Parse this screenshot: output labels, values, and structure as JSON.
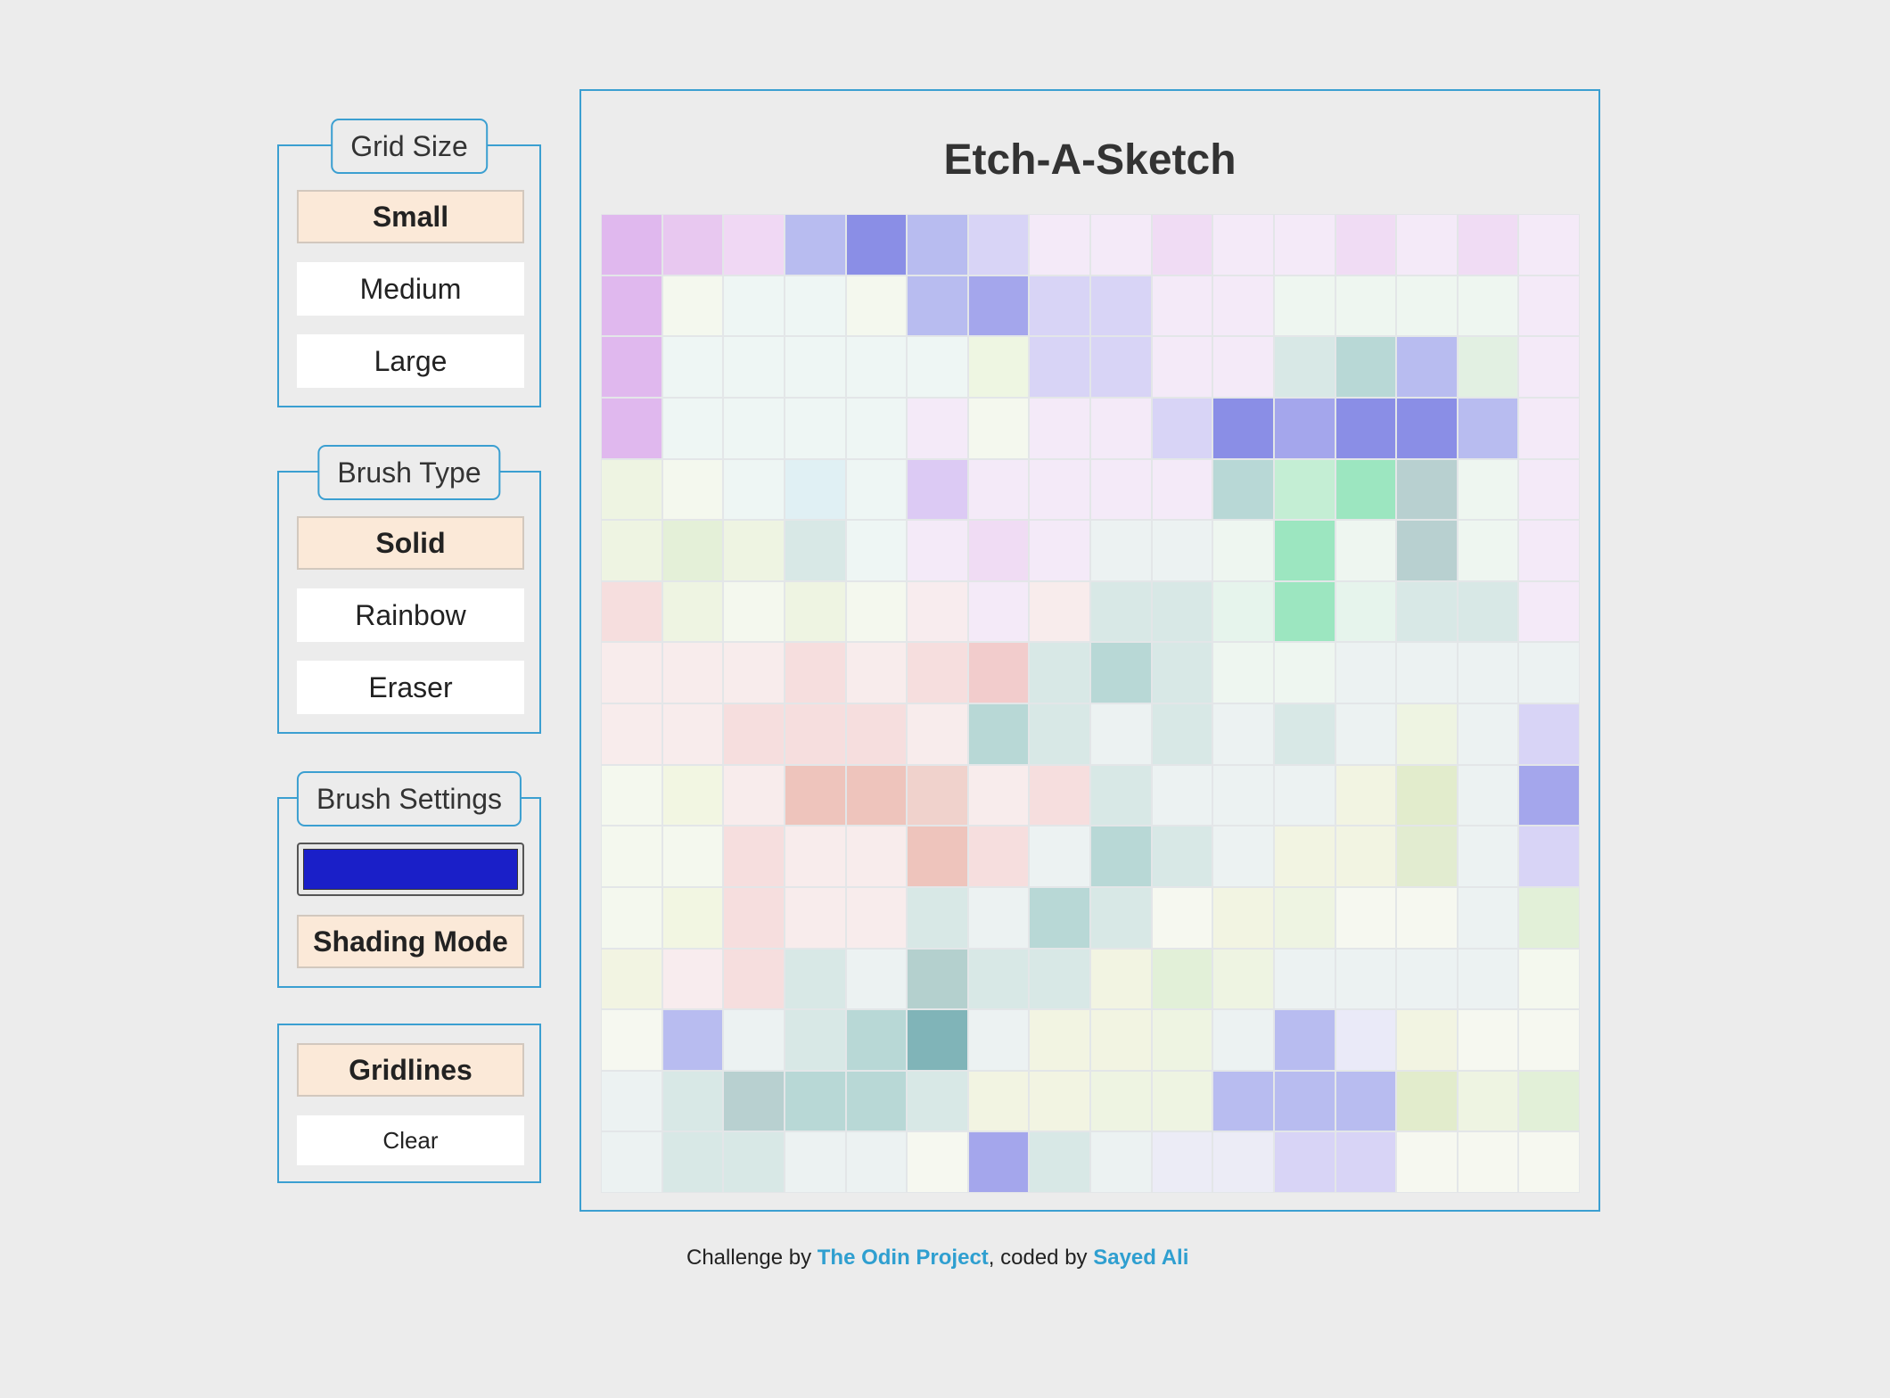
{
  "grid_size": {
    "legend": "Grid Size",
    "options": [
      "Small",
      "Medium",
      "Large"
    ],
    "active": "Small"
  },
  "brush_type": {
    "legend": "Brush Type",
    "options": [
      "Solid",
      "Rainbow",
      "Eraser"
    ],
    "active": "Solid"
  },
  "brush_settings": {
    "legend": "Brush Settings",
    "color": "#1a1fc8",
    "shading_label": "Shading Mode"
  },
  "actions": {
    "gridlines_label": "Gridlines",
    "clear_label": "Clear"
  },
  "title": "Etch-A-Sketch",
  "footer": {
    "prefix": "Challenge by ",
    "odin": "The Odin Project",
    "middle": ", coded by ",
    "author": "Sayed Ali"
  },
  "grid": {
    "size": 16,
    "cells": [
      [
        "#e0b8ee",
        "#e8c8f0",
        "#f0d8f4",
        "#b8bcf0",
        "#8a8ee6",
        "#b8bcf0",
        "#d8d4f6",
        "#f4eaf8",
        "#f4eaf8",
        "#f0dcf4",
        "#f4eaf8",
        "#f4eaf8",
        "#f0dcf4",
        "#f4eaf8",
        "#f0dcf4",
        "#f4eaf8"
      ],
      [
        "#e0b8ee",
        "#f4f8ee",
        "#eef6f4",
        "#eef6f4",
        "#f4f8ee",
        "#b8bcf0",
        "#a4a6ec",
        "#d8d4f6",
        "#d8d4f6",
        "#f4eaf8",
        "#f4eaf8",
        "#eef6f0",
        "#eef6f0",
        "#eef6f0",
        "#eef6f0",
        "#f4eaf8"
      ],
      [
        "#e0b8ee",
        "#eef6f4",
        "#eef6f4",
        "#eef6f4",
        "#eef6f4",
        "#eef6f4",
        "#eef6e2",
        "#d8d4f6",
        "#d8d4f6",
        "#f4eaf8",
        "#f4eaf8",
        "#d8e8e6",
        "#b8d8d6",
        "#b8bcf0",
        "#e2f0e2",
        "#f4eaf8"
      ],
      [
        "#e0b8ee",
        "#eef6f4",
        "#eef6f4",
        "#eef6f4",
        "#eef6f4",
        "#f4eaf8",
        "#f4f8ee",
        "#f4eaf8",
        "#f4eaf8",
        "#d8d4f6",
        "#8a8ee6",
        "#a4a6ec",
        "#8a8ee6",
        "#8a8ee6",
        "#b8bcf0",
        "#f4eaf8"
      ],
      [
        "#eef4e2",
        "#f4f8ee",
        "#eef6f4",
        "#e0f0f4",
        "#eef6f4",
        "#dccaf4",
        "#f4eaf8",
        "#f4eaf8",
        "#f4eaf8",
        "#f4eaf8",
        "#b8d8d6",
        "#c4eed4",
        "#9ce6c0",
        "#b8d0d0",
        "#eef6f0",
        "#f4eaf8"
      ],
      [
        "#eef4e2",
        "#e4f0d8",
        "#eef4e2",
        "#d8e8e6",
        "#eef6f4",
        "#f4eaf8",
        "#f0dcf4",
        "#f4eaf8",
        "#ecf2f2",
        "#ecf2f2",
        "#eef6f0",
        "#9ce6c0",
        "#eef6f0",
        "#b8d0d0",
        "#eef6f0",
        "#f4eaf8"
      ],
      [
        "#f6dede",
        "#eef4e2",
        "#f4f8ee",
        "#eef4e2",
        "#f4f8ee",
        "#f8ecee",
        "#f4eaf8",
        "#f8ecec",
        "#d8e8e6",
        "#d8e8e6",
        "#e6f4ec",
        "#9ce6c0",
        "#e6f4ec",
        "#d8e8e6",
        "#d8e8e6",
        "#f4eaf8"
      ],
      [
        "#f8ecec",
        "#f8ecec",
        "#f8ecec",
        "#f6dede",
        "#f8ecec",
        "#f6dede",
        "#f2cccc",
        "#d8e8e6",
        "#b8d8d6",
        "#d8e8e6",
        "#eef6f0",
        "#eef6f0",
        "#ecf2f2",
        "#ecf2f2",
        "#ecf2f2",
        "#ecf2f2"
      ],
      [
        "#f8ecec",
        "#f8ecec",
        "#f6dede",
        "#f6dede",
        "#f6dede",
        "#f8ecec",
        "#b8d8d6",
        "#d8e8e6",
        "#ecf2f2",
        "#d8e8e6",
        "#ecf2f2",
        "#d8e8e6",
        "#ecf2f2",
        "#eef4e2",
        "#ecf2f2",
        "#d8d4f6"
      ],
      [
        "#f4f8ee",
        "#f2f6e2",
        "#f8ecec",
        "#eec4bc",
        "#eec4bc",
        "#f0d2cc",
        "#f8ecec",
        "#f6dede",
        "#d8e8e6",
        "#ecf2f2",
        "#ecf2f2",
        "#ecf2f2",
        "#f2f4e2",
        "#e2eccc",
        "#ecf2f2",
        "#a4a6ec"
      ],
      [
        "#f4f8ee",
        "#f4f8ee",
        "#f6dede",
        "#f8ecec",
        "#f8ecec",
        "#eec4bc",
        "#f6dede",
        "#ecf2f2",
        "#b8d8d6",
        "#d8e8e6",
        "#ecf2f2",
        "#f2f4e2",
        "#f2f4e2",
        "#e2ecd0",
        "#ecf2f2",
        "#d8d4f6"
      ],
      [
        "#f4f8ee",
        "#f2f6e2",
        "#f6dede",
        "#f8ecec",
        "#f8ecec",
        "#d8e8e6",
        "#ecf2f2",
        "#b8d8d6",
        "#d8e8e6",
        "#f6f8f0",
        "#f2f4e2",
        "#eef4e2",
        "#f6f8f0",
        "#f6f8f0",
        "#ecf2f2",
        "#e2f0d8"
      ],
      [
        "#f2f4e2",
        "#f8ecee",
        "#f6dede",
        "#d8e8e6",
        "#ecf2f2",
        "#b4d0ce",
        "#d8e8e6",
        "#d8e8e6",
        "#f2f4e2",
        "#e2f0d8",
        "#eef4e2",
        "#ecf2f2",
        "#ecf2f2",
        "#ecf2f2",
        "#ecf2f2",
        "#f4f8ee"
      ],
      [
        "#f6f8f0",
        "#b8bcf0",
        "#ecf2f2",
        "#d8e8e6",
        "#b8d8d6",
        "#80b4b8",
        "#ecf2f2",
        "#f2f4e2",
        "#f2f4e2",
        "#eef4e2",
        "#ecf2f2",
        "#b8bcf0",
        "#eaeaf8",
        "#f2f4e2",
        "#f6f8f0",
        "#f6f8f0"
      ],
      [
        "#ecf2f2",
        "#d8e8e6",
        "#b8d0d0",
        "#b8d8d6",
        "#b8d8d6",
        "#d8e8e6",
        "#f2f4e2",
        "#f2f4e2",
        "#eef4e2",
        "#eef4e2",
        "#b8bcf0",
        "#b8bcf0",
        "#b8bcf0",
        "#e2eccc",
        "#eef4e2",
        "#e2f0d8"
      ],
      [
        "#ecf2f2",
        "#d8e8e6",
        "#d8e8e6",
        "#ecf2f2",
        "#ecf2f2",
        "#f6f8f0",
        "#a4a6ec",
        "#d8e8e6",
        "#ecf2f2",
        "#ececf6",
        "#ececf6",
        "#d8d4f6",
        "#d8d4f6",
        "#f6f8f0",
        "#f6f8f0",
        "#f6f8f0"
      ]
    ]
  }
}
